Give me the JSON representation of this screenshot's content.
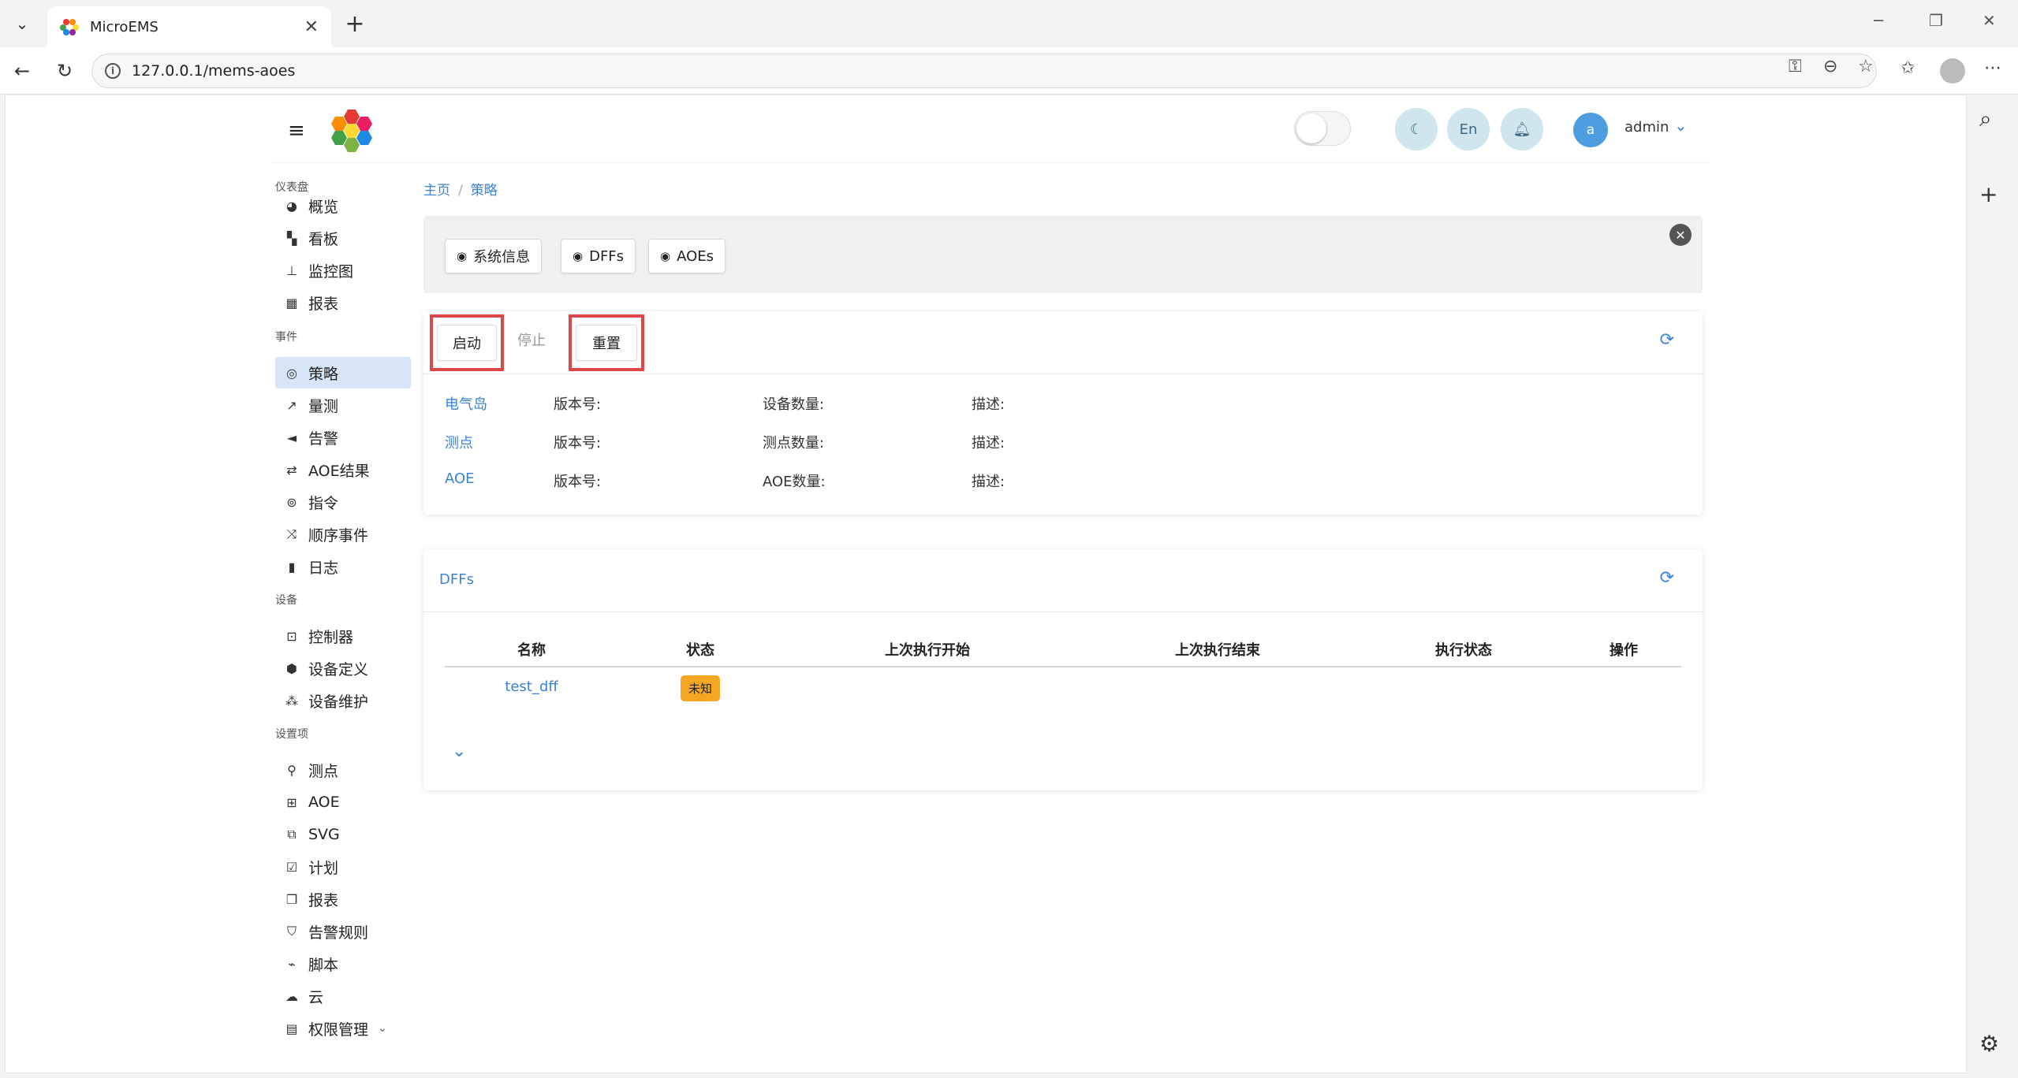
{
  "browser": {
    "tab_title": "MicroEMS",
    "url": "127.0.0.1/mems-aoes"
  },
  "header": {
    "lang_label": "En",
    "avatar_letter": "a",
    "username": "admin"
  },
  "sidebar": {
    "sections": [
      {
        "label": "仪表盘"
      },
      {
        "label": "事件"
      },
      {
        "label": "设备"
      },
      {
        "label": "设置项"
      }
    ],
    "items": [
      {
        "label": "概览",
        "icon": "dashboard-icon"
      },
      {
        "label": "看板",
        "icon": "board-icon"
      },
      {
        "label": "监控图",
        "icon": "sitemap-icon"
      },
      {
        "label": "报表",
        "icon": "table-icon"
      },
      {
        "label": "策略",
        "icon": "compass-icon",
        "active": true
      },
      {
        "label": "量测",
        "icon": "chart-line-icon"
      },
      {
        "label": "告警",
        "icon": "bullhorn-icon"
      },
      {
        "label": "AOE结果",
        "icon": "retweet-icon"
      },
      {
        "label": "指令",
        "icon": "podcast-icon"
      },
      {
        "label": "顺序事件",
        "icon": "random-icon"
      },
      {
        "label": "日志",
        "icon": "book-icon"
      },
      {
        "label": "控制器",
        "icon": "object-group-icon"
      },
      {
        "label": "设备定义",
        "icon": "cube-icon"
      },
      {
        "label": "设备维护",
        "icon": "cubes-icon"
      },
      {
        "label": "测点",
        "icon": "map-pin-icon"
      },
      {
        "label": "AOE",
        "icon": "network-icon"
      },
      {
        "label": "SVG",
        "icon": "clone-icon"
      },
      {
        "label": "计划",
        "icon": "calendar-icon"
      },
      {
        "label": "报表",
        "icon": "copy-icon"
      },
      {
        "label": "告警规则",
        "icon": "shield-icon"
      },
      {
        "label": "脚本",
        "icon": "plug-icon"
      },
      {
        "label": "云",
        "icon": "cloud-icon"
      },
      {
        "label": "权限管理",
        "icon": "id-card-icon"
      }
    ]
  },
  "breadcrumb": {
    "home": "主页",
    "current": "策略"
  },
  "info_panel": {
    "chips": [
      "系统信息",
      "DFFs",
      "AOEs"
    ]
  },
  "control_card": {
    "start_label": "启动",
    "stop_label": "停止",
    "reset_label": "重置",
    "rows": [
      {
        "name": "电气岛",
        "version_label": "版本号:",
        "count_label": "设备数量:",
        "desc_label": "描述:"
      },
      {
        "name": "测点",
        "version_label": "版本号:",
        "count_label": "测点数量:",
        "desc_label": "描述:"
      },
      {
        "name": "AOE",
        "version_label": "版本号:",
        "count_label": "AOE数量:",
        "desc_label": "描述:"
      }
    ]
  },
  "dff_card": {
    "title": "DFFs",
    "columns": [
      "名称",
      "状态",
      "上次执行开始",
      "上次执行结束",
      "执行状态",
      "操作"
    ],
    "rows": [
      {
        "name": "test_dff",
        "status": "未知",
        "last_start": "",
        "last_end": "",
        "exec_status": "",
        "actions": ""
      }
    ]
  },
  "colors": {
    "accent": "#3b82d8",
    "highlight_box": "#e04848",
    "badge_unknown": "#f5a623",
    "active_nav": "#d7e6f6"
  }
}
